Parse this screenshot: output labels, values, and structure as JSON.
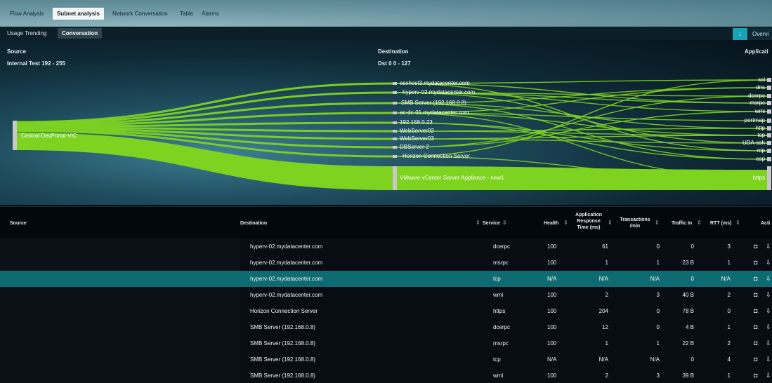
{
  "top_tabs": [
    {
      "label": "Flow Analysis",
      "active": false
    },
    {
      "label": "Subnet analysis",
      "active": true
    },
    {
      "label": "Network Conversation",
      "active": false
    },
    {
      "label": "Table",
      "active": false
    },
    {
      "label": "Alarms",
      "active": false
    }
  ],
  "sub_tabs": [
    {
      "label": "Usage Trending",
      "active": false
    },
    {
      "label": "Conversation",
      "active": true
    }
  ],
  "toolbar": {
    "sort_label": "↓",
    "overview_label": "Overvi"
  },
  "sankey": {
    "source_header": "Source",
    "source_subheader": "Internal Test 192 - 255",
    "destination_header": "Destination",
    "destination_subheader": "Dst 0 0 - 127",
    "application_header": "Applicati",
    "source_node": "Central-DevPortal-VIC",
    "destinations": [
      "esxhost3.mydatacenter.com",
      "hyperv-02.mydatacenter.com",
      "SMB Server (192.168.0.8)",
      "ac-dc-01.mydatacenter.com",
      "192.168.0.23",
      "WebServer02",
      "WebServer03",
      "DBServer-2",
      "Horizon Connection Server",
      "VMware vCenter Server Appliance - new1"
    ],
    "applications": [
      "ssl",
      "dns",
      "dcerpc",
      "msrpc",
      "wmi",
      "portmap",
      "http",
      "tcp",
      "UDA-ssh",
      "ntp",
      "esp",
      "https"
    ],
    "colors": {
      "flow": "#7ed321",
      "flow_dark": "#5fb318",
      "node": "#c8c8c8"
    }
  },
  "table": {
    "headers": {
      "source": "Source",
      "destination": "Destination",
      "service": "Service",
      "health": "Health",
      "response_line1": "Application",
      "response_line2": "Response",
      "response_line3": "Time (ms)",
      "transactions_line1": "Transactions",
      "transactions_line2": "/min",
      "traffic": "Traffic In",
      "rtt": "RTT (ms)",
      "actions": "Acti"
    },
    "rows": [
      {
        "destination": "hyperv-02.mydatacenter.com",
        "service": "dcerpc",
        "health": "100",
        "response": "61",
        "transactions": "0",
        "traffic": "0",
        "rtt": "3",
        "selected": false
      },
      {
        "destination": "hyperv-02.mydatacenter.com",
        "service": "msrpc",
        "health": "100",
        "response": "1",
        "transactions": "1",
        "traffic": "23 B",
        "rtt": "1",
        "selected": false
      },
      {
        "destination": "hyperv-02.mydatacenter.com",
        "service": "tcp",
        "health": "N/A",
        "response": "N/A",
        "transactions": "N/A",
        "traffic": "0",
        "rtt": "N/A",
        "selected": true
      },
      {
        "destination": "hyperv-02.mydatacenter.com",
        "service": "wmi",
        "health": "100",
        "response": "2",
        "transactions": "3",
        "traffic": "40 B",
        "rtt": "2",
        "selected": false
      },
      {
        "destination": "Horizon Connection Server",
        "service": "https",
        "health": "100",
        "response": "204",
        "transactions": "0",
        "traffic": "78 B",
        "rtt": "0",
        "selected": false
      },
      {
        "destination": "SMB Server (192.168.0.8)",
        "service": "dcerpc",
        "health": "100",
        "response": "12",
        "transactions": "0",
        "traffic": "4 B",
        "rtt": "1",
        "selected": false
      },
      {
        "destination": "SMB Server (192.168.0.8)",
        "service": "msrpc",
        "health": "100",
        "response": "1",
        "transactions": "1",
        "traffic": "22 B",
        "rtt": "2",
        "selected": false
      },
      {
        "destination": "SMB Server (192.168.0.8)",
        "service": "tcp",
        "health": "N/A",
        "response": "N/A",
        "transactions": "N/A",
        "traffic": "0",
        "rtt": "4",
        "selected": false
      },
      {
        "destination": "SMB Server (192.168.0.8)",
        "service": "wmi",
        "health": "100",
        "response": "2",
        "transactions": "3",
        "traffic": "39 B",
        "rtt": "1",
        "selected": false
      }
    ]
  }
}
